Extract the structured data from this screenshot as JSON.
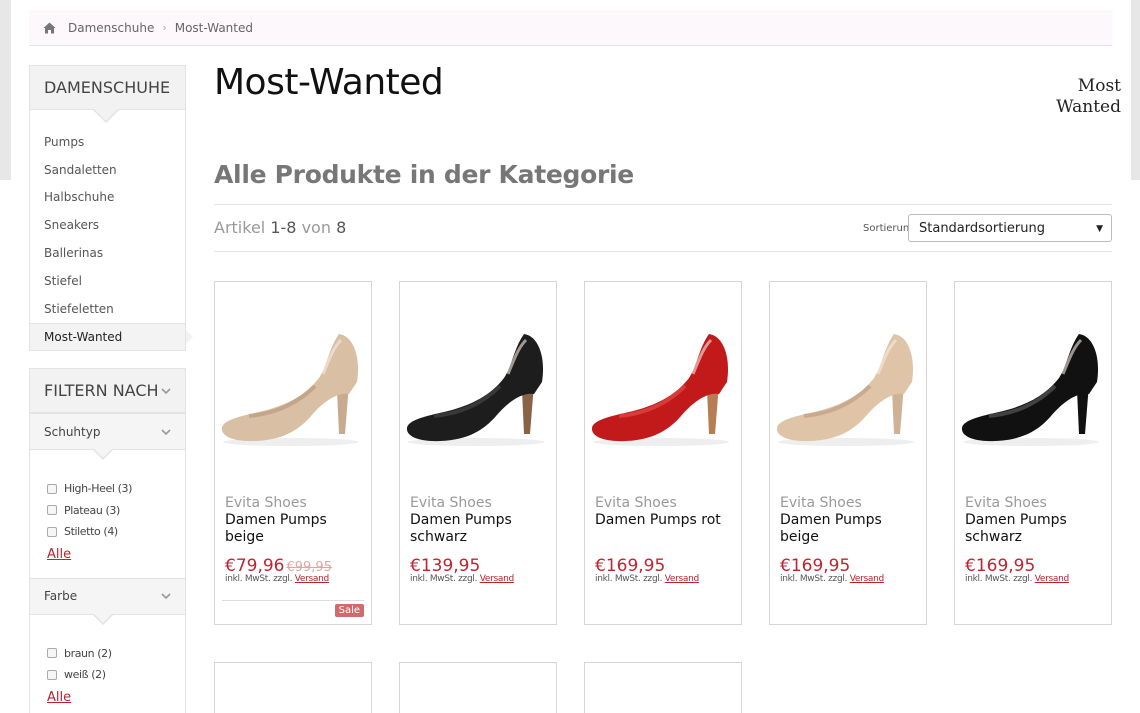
{
  "breadcrumb": {
    "items": [
      "Damenschuhe",
      "Most-Wanted"
    ],
    "separator": "›"
  },
  "sidebar": {
    "category_title": "DAMENSCHUHE",
    "categories": [
      "Pumps",
      "Sandaletten",
      "Halbschuhe",
      "Sneakers",
      "Ballerinas",
      "Stiefel",
      "Stiefeletten",
      "Most-Wanted"
    ],
    "active_category": "Most-Wanted",
    "filter_title": "FILTERN NACH",
    "filters": [
      {
        "title": "Schuhtyp",
        "options": [
          "High-Heel (3)",
          "Plateau (3)",
          "Stiletto (4)"
        ],
        "all_label": "Alle"
      },
      {
        "title": "Farbe",
        "options": [
          "braun (2)",
          "weiß (2)"
        ],
        "all_label": "Alle"
      }
    ]
  },
  "main": {
    "title": "Most-Wanted",
    "logo_text": [
      "Most",
      "Wanted"
    ],
    "subtitle": "Alle Produkte in der Kategorie",
    "count": {
      "prefix": "Artikel",
      "range": "1-8",
      "mid": "von",
      "total": "8"
    },
    "sort": {
      "label": "Sortierung",
      "selected": "Standardsortierung"
    }
  },
  "products": [
    {
      "brand": "Evita Shoes",
      "name": "Damen Pumps beige",
      "price": "€79,96",
      "old_price": "€99,95",
      "tax": "inkl. MwSt. zzgl.",
      "shipping": "Versand",
      "badge": "Sale",
      "shoe_color": "#d9bfa4",
      "shoe_shade": "#b99a7e",
      "heel_color": "#c8ab8f"
    },
    {
      "brand": "Evita Shoes",
      "name": "Damen Pumps schwarz",
      "price": "€139,95",
      "tax": "inkl. MwSt. zzgl.",
      "shipping": "Versand",
      "shoe_color": "#1d1d1d",
      "shoe_shade": "#444444",
      "heel_color": "#8a6347"
    },
    {
      "brand": "Evita Shoes",
      "name": "Damen Pumps rot",
      "price": "€169,95",
      "tax": "inkl. MwSt. zzgl.",
      "shipping": "Versand",
      "shoe_color": "#c21a1a",
      "shoe_shade": "#e34a4a",
      "heel_color": "#b77d54"
    },
    {
      "brand": "Evita Shoes",
      "name": "Damen Pumps beige",
      "price": "€169,95",
      "tax": "inkl. MwSt. zzgl.",
      "shipping": "Versand",
      "shoe_color": "#e0c4a8",
      "shoe_shade": "#bfa084",
      "heel_color": "#cfb194"
    },
    {
      "brand": "Evita Shoes",
      "name": "Damen Pumps schwarz",
      "price": "€169,95",
      "tax": "inkl. MwSt. zzgl.",
      "shipping": "Versand",
      "shoe_color": "#111111",
      "shoe_shade": "#555555",
      "heel_color": "#111111"
    }
  ],
  "colors": {
    "accent": "#c0242f",
    "link": "#b8232f",
    "sale_badge": "#d16b6b"
  }
}
